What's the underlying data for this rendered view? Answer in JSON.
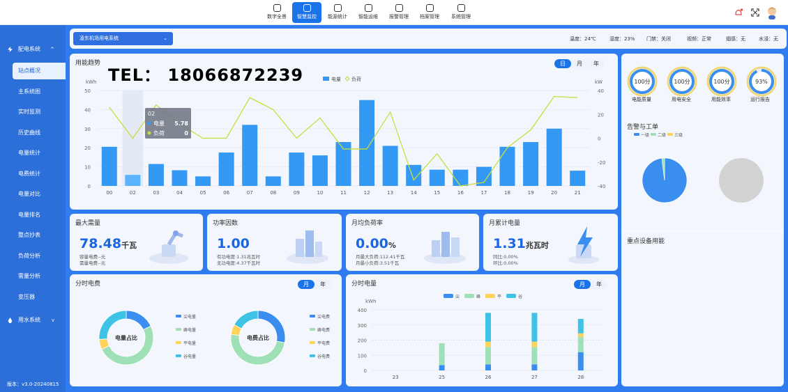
{
  "nav": [
    {
      "label": "数字全景",
      "active": false
    },
    {
      "label": "智慧监控",
      "active": true
    },
    {
      "label": "能源统计",
      "active": false
    },
    {
      "label": "智能运维",
      "active": false
    },
    {
      "label": "报警管理",
      "active": false
    },
    {
      "label": "档案管理",
      "active": false
    },
    {
      "label": "系统管理",
      "active": false
    }
  ],
  "sidebar": {
    "group1": "配电系统",
    "group2": "用水系统",
    "items": [
      "站点概况",
      "主系统图",
      "实时监测",
      "历史曲线",
      "电量统计",
      "电费统计",
      "电量对比",
      "电量排名",
      "整点抄表",
      "负荷分析",
      "需量分析",
      "变压器"
    ],
    "version": "版本：v3.0-20240815"
  },
  "system_select": "凌东机场用电系统",
  "env": [
    "温度：24℃",
    "湿度：23%",
    "门禁：关闭",
    "视频：正常",
    "烟感：无",
    "水浸：无"
  ],
  "trend": {
    "title": "用能趋势",
    "tabs": [
      "日",
      "月",
      "年"
    ],
    "active_tab": "日",
    "overlay": "TEL： 18066872239",
    "legend_energy": "电量",
    "legend_load": "负荷",
    "unit_left": "kWh",
    "unit_right": "kW",
    "tooltip": {
      "hour": "02",
      "energy_label": "电量",
      "energy_value": "5.78",
      "load_label": "负荷",
      "load_value": "0"
    }
  },
  "chart_data": [
    {
      "type": "bar",
      "title": "用能趋势",
      "categories": [
        "00",
        "02",
        "03",
        "04",
        "05",
        "06",
        "07",
        "08",
        "09",
        "10",
        "11",
        "12",
        "13",
        "14",
        "15",
        "16",
        "17",
        "18",
        "19",
        "20",
        "21"
      ],
      "series": [
        {
          "name": "电量",
          "axis": "left",
          "values": [
            20.5,
            5.78,
            11.5,
            8.2,
            5,
            17.5,
            32,
            5,
            17.5,
            16,
            23,
            45,
            21,
            11,
            8.5,
            8.5,
            10,
            20.5,
            23,
            30,
            8
          ]
        },
        {
          "name": "负荷",
          "type": "line",
          "axis": "right",
          "values": [
            26,
            0,
            28,
            12,
            0,
            0,
            34,
            24,
            0,
            17,
            -9,
            -9,
            22,
            -35,
            -13,
            -40,
            -37,
            -8,
            7,
            35,
            34
          ]
        }
      ],
      "ylim_left": [
        0,
        50
      ],
      "ylim_right": [
        -40,
        40
      ],
      "yticks_left": [
        0,
        10,
        20,
        30,
        40,
        50
      ],
      "yticks_right": [
        -40,
        -20,
        0,
        20,
        40
      ]
    },
    {
      "type": "pie",
      "title": "电量占比",
      "series": [
        {
          "name": "尖电量",
          "value": 18
        },
        {
          "name": "峰电量",
          "value": 50
        },
        {
          "name": "平电量",
          "value": 6
        },
        {
          "name": "谷电量",
          "value": 26
        }
      ]
    },
    {
      "type": "pie",
      "title": "电费占比",
      "series": [
        {
          "name": "尖电费",
          "value": 28
        },
        {
          "name": "峰电费",
          "value": 49
        },
        {
          "name": "平电费",
          "value": 6
        },
        {
          "name": "谷电费",
          "value": 17
        }
      ]
    },
    {
      "type": "bar",
      "stacked": true,
      "title": "分时电量",
      "categories": [
        "23",
        "25",
        "26",
        "27",
        "28"
      ],
      "ylabel": "kWh",
      "ylim": [
        0,
        400
      ],
      "yticks": [
        0,
        100,
        200,
        300,
        400
      ],
      "series": [
        {
          "name": "尖",
          "values": [
            0,
            35,
            40,
            40,
            120
          ]
        },
        {
          "name": "峰",
          "values": [
            0,
            145,
            115,
            115,
            100
          ]
        },
        {
          "name": "平",
          "values": [
            0,
            0,
            35,
            35,
            25
          ]
        },
        {
          "name": "谷",
          "values": [
            0,
            0,
            190,
            190,
            95
          ]
        }
      ]
    },
    {
      "type": "pie",
      "title": "告警与工单",
      "series": [
        {
          "name": "一级",
          "value": 98
        },
        {
          "name": "二级",
          "value": 2
        }
      ]
    }
  ],
  "kpis": [
    {
      "title": "最大需量",
      "value": "78.48",
      "unit": "千瓦",
      "subs": [
        "容量电费--元",
        "需量电费--元"
      ]
    },
    {
      "title": "功率因数",
      "value": "1.00",
      "unit": "",
      "subs": [
        "有功电度:1.31兆瓦时",
        "无功电度:4.37千瓦时"
      ]
    },
    {
      "title": "月均负荷率",
      "value": "0.00",
      "unit": "%",
      "subs": [
        "月最大负荷:112.41千瓦",
        "月最小负荷:3.51千瓦"
      ]
    },
    {
      "title": "月累计电量",
      "value": "1.31",
      "unit": "兆瓦时",
      "subs": [
        "同比:0.00%",
        "环比:0.00%"
      ]
    }
  ],
  "tou_fee": {
    "title": "分时电费",
    "tabs": [
      "月",
      "年"
    ],
    "center1": "电量占比",
    "center2": "电费占比"
  },
  "tou_energy": {
    "title": "分时电量",
    "tabs": [
      "月",
      "年"
    ],
    "unit": "kWh"
  },
  "gauges": [
    {
      "value": "100分",
      "label": "电能质量",
      "pct": 100
    },
    {
      "value": "100分",
      "label": "用电安全",
      "pct": 100
    },
    {
      "value": "100分",
      "label": "用能效率",
      "pct": 100
    },
    {
      "value": "93%",
      "label": "运行报告",
      "pct": 93
    }
  ],
  "alarm": {
    "title": "告警与工单",
    "legend": [
      "一级",
      "二级",
      "三级"
    ]
  },
  "key_equipment": {
    "title": "重点设备用能"
  },
  "colors": {
    "primary": "#1a73e8",
    "sidebar": "#2d6fd9",
    "bar": "#3399f5",
    "line": "#c8dd3c",
    "jian": "#3a8ef0",
    "feng": "#9fe0b7",
    "ping": "#ffd25a",
    "gu": "#3ec3e6"
  }
}
